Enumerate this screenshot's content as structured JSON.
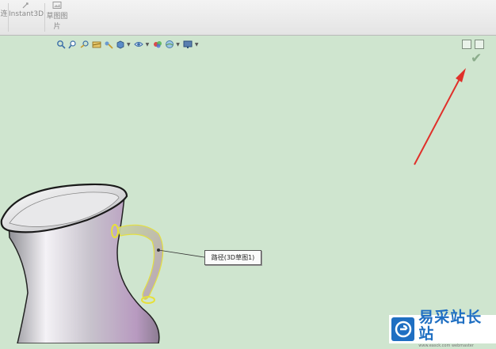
{
  "ribbon": {
    "cut_label": "连",
    "instant3d_label": "Instant3D",
    "sketch_picture_label_line1": "草图图",
    "sketch_picture_label_line2": "片"
  },
  "heads_up_toolbar": {
    "icons": [
      "zoom-to-fit-icon",
      "zoom-to-area-icon",
      "previous-view-icon",
      "section-view-icon",
      "view-orientation-icon",
      "display-style-icon",
      "hide-show-items-icon",
      "edit-appearance-icon",
      "apply-scene-icon",
      "view-settings-icon"
    ]
  },
  "confirm": {
    "icon": "confirm-check-icon"
  },
  "callout": {
    "text": "路径(3D草图1)"
  },
  "watermark": {
    "title": "易采站长站",
    "url": "www.easck.com webmaster"
  },
  "colors": {
    "viewport_background": "#cfe5cf",
    "annotation_arrow": "#e0302a",
    "path_highlight": "#e6e03a"
  }
}
